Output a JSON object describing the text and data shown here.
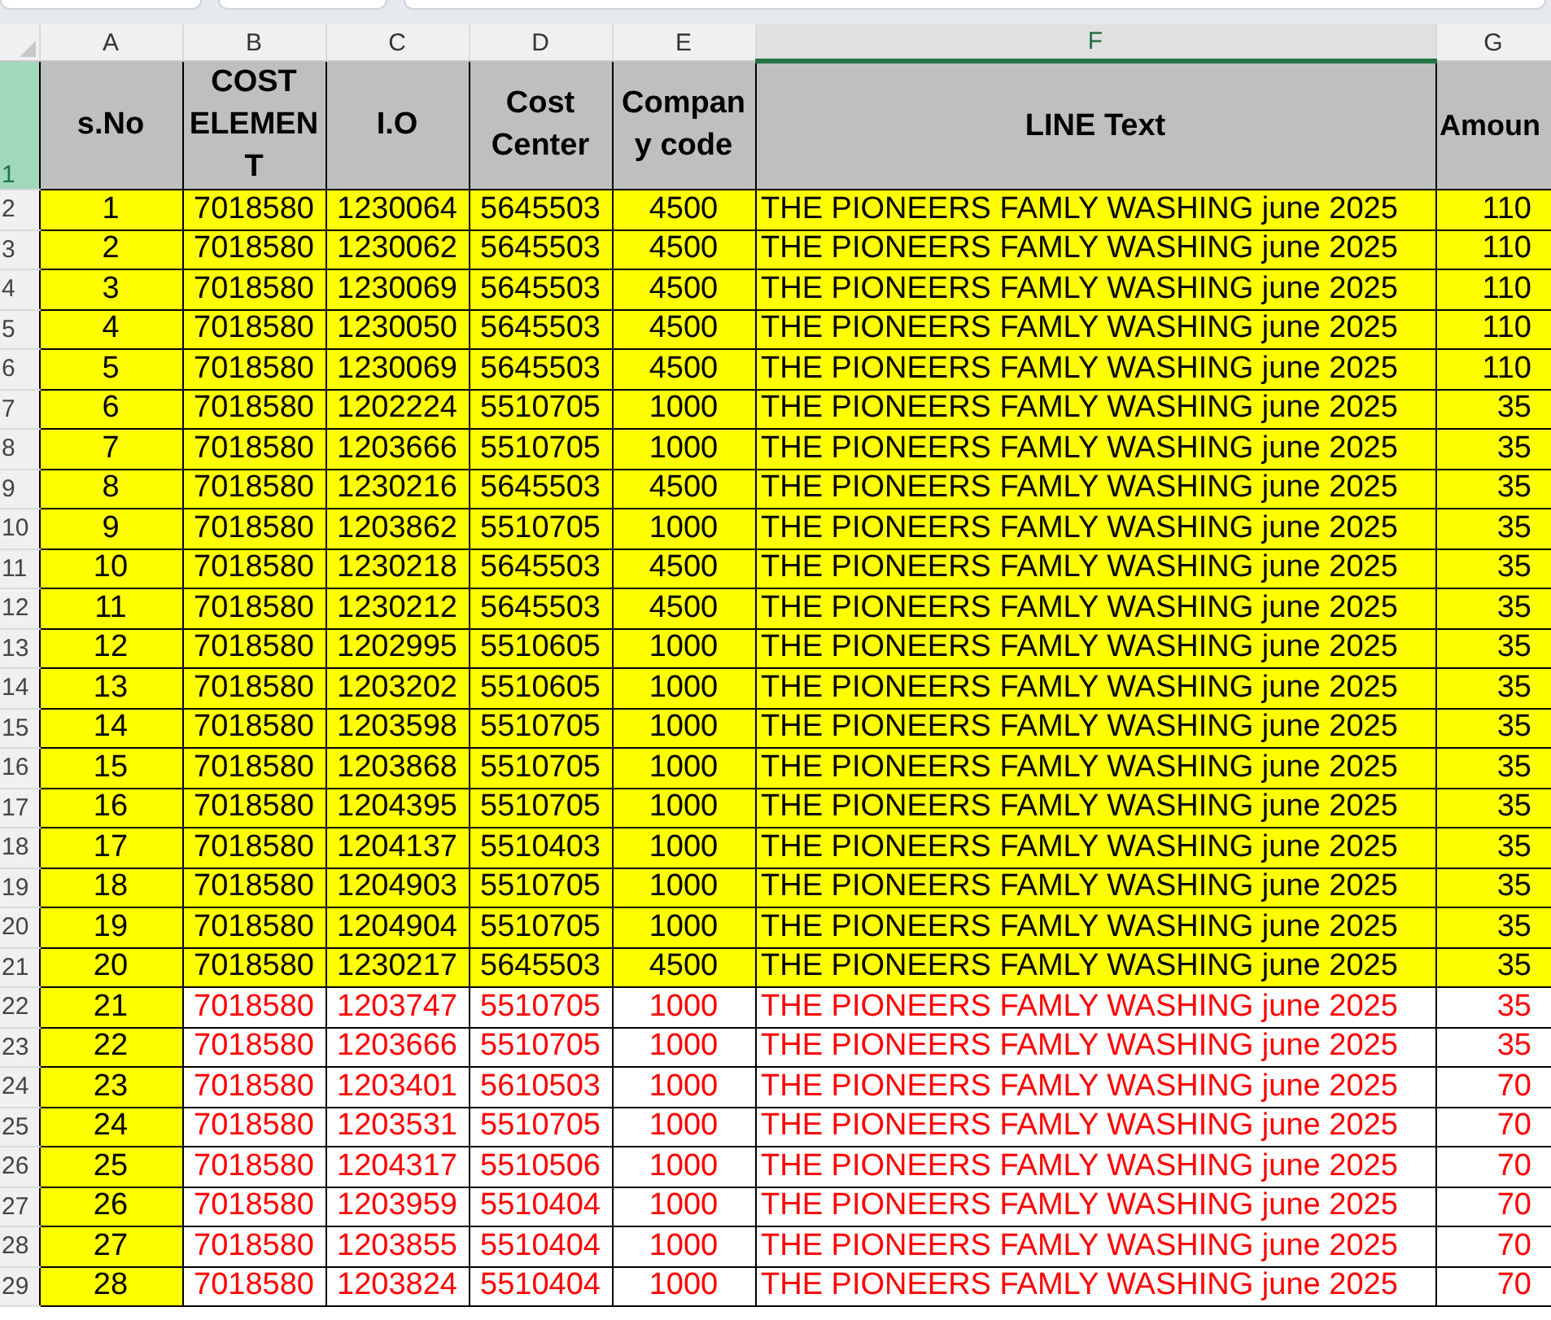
{
  "sheet_tabs": [
    {
      "selected": false
    },
    {
      "selected": false
    },
    {
      "selected": false
    }
  ],
  "columns": [
    {
      "letter": "A",
      "selected": false
    },
    {
      "letter": "B",
      "selected": false
    },
    {
      "letter": "C",
      "selected": false
    },
    {
      "letter": "D",
      "selected": false
    },
    {
      "letter": "E",
      "selected": false
    },
    {
      "letter": "F",
      "selected": true
    },
    {
      "letter": "G",
      "selected": false
    }
  ],
  "header": {
    "row_number": "1",
    "selected": true,
    "cells": [
      "s.No",
      "COST ELEMENT",
      "I.O",
      "Cost Center",
      "Company code",
      "LINE Text",
      "Amoun"
    ]
  },
  "rows": [
    {
      "row_number": "2",
      "kind": "normal",
      "cells": [
        "1",
        "7018580",
        "1230064",
        "5645503",
        "4500",
        "THE PIONEERS FAMLY WASHING june 2025",
        "110"
      ]
    },
    {
      "row_number": "3",
      "kind": "normal",
      "cells": [
        "2",
        "7018580",
        "1230062",
        "5645503",
        "4500",
        "THE PIONEERS FAMLY WASHING june 2025",
        "110"
      ]
    },
    {
      "row_number": "4",
      "kind": "normal",
      "cells": [
        "3",
        "7018580",
        "1230069",
        "5645503",
        "4500",
        "THE PIONEERS FAMLY WASHING june 2025",
        "110"
      ]
    },
    {
      "row_number": "5",
      "kind": "normal",
      "cells": [
        "4",
        "7018580",
        "1230050",
        "5645503",
        "4500",
        "THE PIONEERS FAMLY WASHING june 2025",
        "110"
      ]
    },
    {
      "row_number": "6",
      "kind": "normal",
      "cells": [
        "5",
        "7018580",
        "1230069",
        "5645503",
        "4500",
        "THE PIONEERS FAMLY WASHING june 2025",
        "110"
      ]
    },
    {
      "row_number": "7",
      "kind": "normal",
      "cells": [
        "6",
        "7018580",
        "1202224",
        "5510705",
        "1000",
        "THE PIONEERS FAMLY WASHING june 2025",
        "35"
      ]
    },
    {
      "row_number": "8",
      "kind": "normal",
      "cells": [
        "7",
        "7018580",
        "1203666",
        "5510705",
        "1000",
        "THE PIONEERS FAMLY WASHING june 2025",
        "35"
      ]
    },
    {
      "row_number": "9",
      "kind": "normal",
      "cells": [
        "8",
        "7018580",
        "1230216",
        "5645503",
        "4500",
        "THE PIONEERS FAMLY WASHING june 2025",
        "35"
      ]
    },
    {
      "row_number": "10",
      "kind": "normal",
      "cells": [
        "9",
        "7018580",
        "1203862",
        "5510705",
        "1000",
        "THE PIONEERS FAMLY WASHING june 2025",
        "35"
      ]
    },
    {
      "row_number": "11",
      "kind": "normal",
      "cells": [
        "10",
        "7018580",
        "1230218",
        "5645503",
        "4500",
        "THE PIONEERS FAMLY WASHING june 2025",
        "35"
      ]
    },
    {
      "row_number": "12",
      "kind": "normal",
      "cells": [
        "11",
        "7018580",
        "1230212",
        "5645503",
        "4500",
        "THE PIONEERS FAMLY WASHING june 2025",
        "35"
      ]
    },
    {
      "row_number": "13",
      "kind": "normal",
      "cells": [
        "12",
        "7018580",
        "1202995",
        "5510605",
        "1000",
        "THE PIONEERS FAMLY WASHING june 2025",
        "35"
      ]
    },
    {
      "row_number": "14",
      "kind": "normal",
      "cells": [
        "13",
        "7018580",
        "1203202",
        "5510605",
        "1000",
        "THE PIONEERS FAMLY WASHING june 2025",
        "35"
      ]
    },
    {
      "row_number": "15",
      "kind": "normal",
      "cells": [
        "14",
        "7018580",
        "1203598",
        "5510705",
        "1000",
        "THE PIONEERS FAMLY WASHING june 2025",
        "35"
      ]
    },
    {
      "row_number": "16",
      "kind": "normal",
      "cells": [
        "15",
        "7018580",
        "1203868",
        "5510705",
        "1000",
        "THE PIONEERS FAMLY WASHING june 2025",
        "35"
      ]
    },
    {
      "row_number": "17",
      "kind": "normal",
      "cells": [
        "16",
        "7018580",
        "1204395",
        "5510705",
        "1000",
        "THE PIONEERS FAMLY WASHING june 2025",
        "35"
      ]
    },
    {
      "row_number": "18",
      "kind": "normal",
      "cells": [
        "17",
        "7018580",
        "1204137",
        "5510403",
        "1000",
        "THE PIONEERS FAMLY WASHING june 2025",
        "35"
      ]
    },
    {
      "row_number": "19",
      "kind": "normal",
      "cells": [
        "18",
        "7018580",
        "1204903",
        "5510705",
        "1000",
        "THE PIONEERS FAMLY WASHING june 2025",
        "35"
      ]
    },
    {
      "row_number": "20",
      "kind": "normal",
      "cells": [
        "19",
        "7018580",
        "1204904",
        "5510705",
        "1000",
        "THE PIONEERS FAMLY WASHING june 2025",
        "35"
      ]
    },
    {
      "row_number": "21",
      "kind": "normal",
      "cells": [
        "20",
        "7018580",
        "1230217",
        "5645503",
        "4500",
        "THE PIONEERS FAMLY WASHING june 2025",
        "35"
      ]
    },
    {
      "row_number": "22",
      "kind": "flagged",
      "cells": [
        "21",
        "7018580",
        "1203747",
        "5510705",
        "1000",
        "THE PIONEERS FAMLY WASHING june 2025",
        "35"
      ]
    },
    {
      "row_number": "23",
      "kind": "flagged",
      "cells": [
        "22",
        "7018580",
        "1203666",
        "5510705",
        "1000",
        "THE PIONEERS FAMLY WASHING june 2025",
        "35"
      ]
    },
    {
      "row_number": "24",
      "kind": "flagged",
      "cells": [
        "23",
        "7018580",
        "1203401",
        "5610503",
        "1000",
        "THE PIONEERS FAMLY WASHING june 2025",
        "70"
      ]
    },
    {
      "row_number": "25",
      "kind": "flagged",
      "cells": [
        "24",
        "7018580",
        "1203531",
        "5510705",
        "1000",
        "THE PIONEERS FAMLY WASHING june 2025",
        "70"
      ]
    },
    {
      "row_number": "26",
      "kind": "flagged",
      "cells": [
        "25",
        "7018580",
        "1204317",
        "5510506",
        "1000",
        "THE PIONEERS FAMLY WASHING june 2025",
        "70"
      ]
    },
    {
      "row_number": "27",
      "kind": "flagged",
      "cells": [
        "26",
        "7018580",
        "1203959",
        "5510404",
        "1000",
        "THE PIONEERS FAMLY WASHING june 2025",
        "70"
      ]
    },
    {
      "row_number": "28",
      "kind": "flagged",
      "cells": [
        "27",
        "7018580",
        "1203855",
        "5510404",
        "1000",
        "THE PIONEERS FAMLY WASHING june 2025",
        "70"
      ]
    },
    {
      "row_number": "29",
      "kind": "flagged",
      "cells": [
        "28",
        "7018580",
        "1203824",
        "5510404",
        "1000",
        "THE PIONEERS FAMLY WASHING june 2025",
        "70"
      ]
    }
  ]
}
